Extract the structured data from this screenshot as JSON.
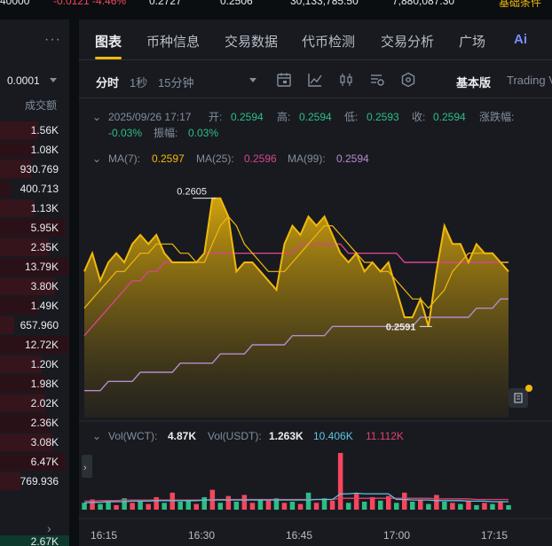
{
  "ticker": {
    "items": [
      "40000",
      "-0.0121 -4.46%",
      "0.2727",
      "0.2506",
      "30,133,785.50",
      "7,880,087.30",
      "基础条件"
    ]
  },
  "orderbook": {
    "precision": "0.0001",
    "column_header": "成交额",
    "rows": [
      {
        "value": "1.56K",
        "depth": 0.55
      },
      {
        "value": "1.08K",
        "depth": 0.5
      },
      {
        "value": "930.769",
        "depth": 0.45
      },
      {
        "value": "400.713",
        "depth": 0.15
      },
      {
        "value": "1.13K",
        "depth": 0.5
      },
      {
        "value": "5.95K",
        "depth": 0.95
      },
      {
        "value": "2.35K",
        "depth": 0.7
      },
      {
        "value": "13.79K",
        "depth": 1.0
      },
      {
        "value": "3.80K",
        "depth": 0.8
      },
      {
        "value": "1.49K",
        "depth": 0.55
      },
      {
        "value": "657.960",
        "depth": 0.2
      },
      {
        "value": "12.72K",
        "depth": 1.0
      },
      {
        "value": "1.20K",
        "depth": 0.6
      },
      {
        "value": "1.98K",
        "depth": 0.65
      },
      {
        "value": "2.02K",
        "depth": 0.65
      },
      {
        "value": "2.36K",
        "depth": 0.7
      },
      {
        "value": "3.08K",
        "depth": 0.75
      },
      {
        "value": "6.47K",
        "depth": 0.95
      },
      {
        "value": "769.936",
        "depth": 0.3
      }
    ],
    "bottom_value": "2.67K"
  },
  "tabs": [
    {
      "label": "图表",
      "active": true
    },
    {
      "label": "币种信息"
    },
    {
      "label": "交易数据"
    },
    {
      "label": "代币检测"
    },
    {
      "label": "交易分析"
    },
    {
      "label": "广场"
    }
  ],
  "ai_label": "Ai",
  "toolbar": {
    "timeframes": [
      {
        "label": "分时",
        "active": true
      },
      {
        "label": "1秒"
      },
      {
        "label": "15分钟"
      }
    ],
    "icons": [
      "calendar-icon",
      "line-chart-icon",
      "candlestick-icon",
      "settings-list-icon",
      "hexagon-icon"
    ],
    "basic_label": "基本版",
    "tradingview_label": "Trading V"
  },
  "info": {
    "date": "2025/09/26 17:17",
    "open_label": "开:",
    "open": "0.2594",
    "high_label": "高:",
    "high": "0.2594",
    "low_label": "低:",
    "low": "0.2593",
    "close_label": "收:",
    "close": "0.2594",
    "change_label": "涨跌幅:",
    "change": "-0.03%",
    "amplitude_label": "振幅:",
    "amplitude": "0.03%"
  },
  "ma": {
    "ma7_label": "MA(7):",
    "ma7": "0.2597",
    "ma25_label": "MA(25):",
    "ma25": "0.2596",
    "ma99_label": "MA(99):",
    "ma99": "0.2594"
  },
  "vol": {
    "wct_label": "Vol(WCT):",
    "wct": "4.87K",
    "usdt_label": "Vol(USDT):",
    "usdt": "1.263K",
    "v3": "10.406K",
    "v4": "11.112K"
  },
  "colors": {
    "accent": "#f0b90b",
    "up": "#2ebd85",
    "down": "#f6465d",
    "ma7": "#f0b90b",
    "ma25": "#d6448f",
    "ma99": "#b48ccf",
    "vol_ma1": "#5ec4e0",
    "vol_ma2": "#e0416b"
  },
  "chart_data": {
    "type": "area",
    "x_ticks": [
      "16:15",
      "16:30",
      "16:45",
      "17:00",
      "17:15"
    ],
    "annotations": {
      "high": "0.2605",
      "low": "0.2591"
    },
    "price": [
      0.2597,
      0.2599,
      0.2596,
      0.2598,
      0.2599,
      0.2598,
      0.26,
      0.2601,
      0.26,
      0.2601,
      0.2599,
      0.2598,
      0.2598,
      0.2598,
      0.2598,
      0.2599,
      0.2605,
      0.2605,
      0.2603,
      0.2597,
      0.2598,
      0.2598,
      0.2597,
      0.2596,
      0.2595,
      0.26,
      0.2602,
      0.2601,
      0.2603,
      0.2602,
      0.2603,
      0.2601,
      0.2599,
      0.2598,
      0.2599,
      0.2597,
      0.2598,
      0.2597,
      0.2598,
      0.2595,
      0.2592,
      0.2592,
      0.2594,
      0.2591,
      0.2597,
      0.2602,
      0.26,
      0.26,
      0.2598,
      0.26,
      0.2599,
      0.2599,
      0.2598,
      0.2597
    ],
    "ma7": [
      0.2593,
      0.2594,
      0.2595,
      0.2596,
      0.2597,
      0.2597,
      0.2598,
      0.2599,
      0.2599,
      0.26,
      0.26,
      0.26,
      0.2599,
      0.2599,
      0.2598,
      0.2598,
      0.26,
      0.2602,
      0.2603,
      0.2602,
      0.26,
      0.2599,
      0.2598,
      0.2597,
      0.2597,
      0.2597,
      0.2598,
      0.2599,
      0.26,
      0.2601,
      0.2602,
      0.2602,
      0.2601,
      0.26,
      0.2599,
      0.2598,
      0.2598,
      0.2597,
      0.2597,
      0.2596,
      0.2595,
      0.2594,
      0.2594,
      0.2593,
      0.2594,
      0.2595,
      0.2597,
      0.2598,
      0.2599,
      0.2599,
      0.2599,
      0.2599,
      0.2598,
      0.2598
    ],
    "ma25": [
      0.259,
      0.2591,
      0.2592,
      0.2593,
      0.2594,
      0.2595,
      0.2596,
      0.2596,
      0.2597,
      0.2597,
      0.2598,
      0.2598,
      0.2598,
      0.2598,
      0.2598,
      0.2599,
      0.2599,
      0.2599,
      0.2599,
      0.2599,
      0.2599,
      0.2599,
      0.2599,
      0.2599,
      0.2599,
      0.2599,
      0.2599,
      0.26,
      0.26,
      0.26,
      0.26,
      0.26,
      0.26,
      0.2599,
      0.2599,
      0.2599,
      0.2599,
      0.2599,
      0.2599,
      0.2599,
      0.2598,
      0.2598,
      0.2598,
      0.2598,
      0.2598,
      0.2598,
      0.2598,
      0.2598,
      0.2598,
      0.2598,
      0.2598,
      0.2598,
      0.2598,
      0.2598
    ],
    "ma99": [
      0.2584,
      0.2584,
      0.2584,
      0.2585,
      0.2585,
      0.2585,
      0.2585,
      0.2586,
      0.2586,
      0.2586,
      0.2586,
      0.2586,
      0.2587,
      0.2587,
      0.2587,
      0.2587,
      0.2587,
      0.2588,
      0.2588,
      0.2588,
      0.2588,
      0.2589,
      0.2589,
      0.2589,
      0.2589,
      0.2589,
      0.259,
      0.259,
      0.259,
      0.259,
      0.259,
      0.2591,
      0.2591,
      0.2591,
      0.2591,
      0.2591,
      0.2591,
      0.2591,
      0.2591,
      0.2591,
      0.2591,
      0.2591,
      0.2592,
      0.2592,
      0.2592,
      0.2592,
      0.2592,
      0.2592,
      0.2592,
      0.2593,
      0.2593,
      0.2593,
      0.2594,
      0.2594
    ],
    "ylim": [
      0.2583,
      0.2607
    ],
    "volumes": [
      {
        "v": 0.12,
        "up": true
      },
      {
        "v": 0.18,
        "up": false
      },
      {
        "v": 0.1,
        "up": true
      },
      {
        "v": 0.15,
        "up": true
      },
      {
        "v": 0.08,
        "up": false
      },
      {
        "v": 0.2,
        "up": true
      },
      {
        "v": 0.12,
        "up": false
      },
      {
        "v": 0.14,
        "up": true
      },
      {
        "v": 0.1,
        "up": false
      },
      {
        "v": 0.22,
        "up": false
      },
      {
        "v": 0.12,
        "up": true
      },
      {
        "v": 0.3,
        "up": false
      },
      {
        "v": 0.14,
        "up": true
      },
      {
        "v": 0.18,
        "up": true
      },
      {
        "v": 0.1,
        "up": false
      },
      {
        "v": 0.22,
        "up": true
      },
      {
        "v": 0.35,
        "up": false
      },
      {
        "v": 0.12,
        "up": true
      },
      {
        "v": 0.24,
        "up": false
      },
      {
        "v": 0.14,
        "up": true
      },
      {
        "v": 0.26,
        "up": false
      },
      {
        "v": 0.12,
        "up": false
      },
      {
        "v": 0.18,
        "up": true
      },
      {
        "v": 0.16,
        "up": false
      },
      {
        "v": 0.2,
        "up": true
      },
      {
        "v": 0.12,
        "up": false
      },
      {
        "v": 0.14,
        "up": true
      },
      {
        "v": 0.1,
        "up": false
      },
      {
        "v": 0.3,
        "up": true
      },
      {
        "v": 0.12,
        "up": false
      },
      {
        "v": 0.2,
        "up": true
      },
      {
        "v": 0.16,
        "up": false
      },
      {
        "v": 1.0,
        "up": false
      },
      {
        "v": 0.12,
        "up": true
      },
      {
        "v": 0.28,
        "up": false
      },
      {
        "v": 0.14,
        "up": true
      },
      {
        "v": 0.22,
        "up": false
      },
      {
        "v": 0.16,
        "up": true
      },
      {
        "v": 0.24,
        "up": false
      },
      {
        "v": 0.12,
        "up": true
      },
      {
        "v": 0.3,
        "up": false
      },
      {
        "v": 0.14,
        "up": true
      },
      {
        "v": 0.18,
        "up": false
      },
      {
        "v": 0.1,
        "up": true
      },
      {
        "v": 0.26,
        "up": false
      },
      {
        "v": 0.14,
        "up": true
      },
      {
        "v": 0.12,
        "up": false
      },
      {
        "v": 0.1,
        "up": true
      },
      {
        "v": 0.16,
        "up": false
      },
      {
        "v": 0.08,
        "up": true
      },
      {
        "v": 0.12,
        "up": false
      },
      {
        "v": 0.1,
        "up": true
      },
      {
        "v": 0.14,
        "up": false
      },
      {
        "v": 0.08,
        "up": true
      }
    ],
    "vol_ma1": [
      0.12,
      0.13,
      0.13,
      0.14,
      0.14,
      0.14,
      0.15,
      0.15,
      0.15,
      0.16,
      0.16,
      0.16,
      0.16,
      0.16,
      0.16,
      0.17,
      0.17,
      0.17,
      0.17,
      0.17,
      0.17,
      0.17,
      0.17,
      0.17,
      0.17,
      0.17,
      0.17,
      0.17,
      0.17,
      0.18,
      0.18,
      0.18,
      0.28,
      0.28,
      0.29,
      0.28,
      0.28,
      0.28,
      0.28,
      0.18,
      0.18,
      0.17,
      0.17,
      0.17,
      0.16,
      0.16,
      0.16,
      0.16,
      0.15,
      0.15,
      0.15,
      0.14,
      0.14,
      0.14
    ],
    "vol_ma2": [
      0.15,
      0.15,
      0.16,
      0.16,
      0.16,
      0.17,
      0.17,
      0.17,
      0.17,
      0.17,
      0.17,
      0.17,
      0.17,
      0.17,
      0.17,
      0.17,
      0.18,
      0.18,
      0.18,
      0.18,
      0.18,
      0.18,
      0.18,
      0.18,
      0.18,
      0.18,
      0.18,
      0.18,
      0.18,
      0.18,
      0.18,
      0.18,
      0.2,
      0.2,
      0.2,
      0.2,
      0.2,
      0.2,
      0.2,
      0.2,
      0.2,
      0.2,
      0.2,
      0.2,
      0.19,
      0.19,
      0.19,
      0.19,
      0.19,
      0.18,
      0.18,
      0.18,
      0.18,
      0.18
    ]
  }
}
